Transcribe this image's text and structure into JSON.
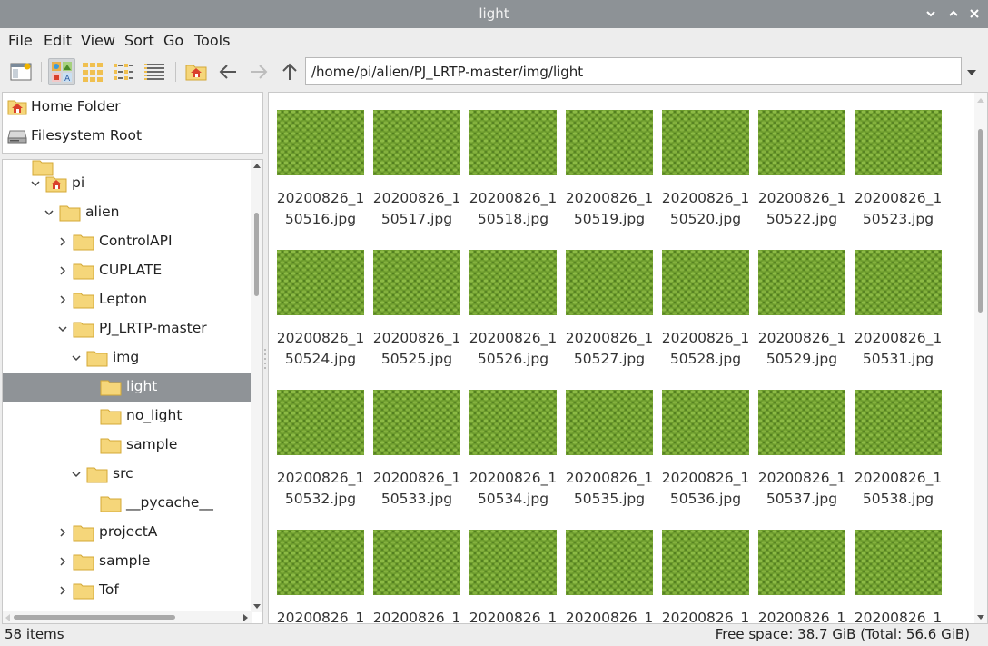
{
  "window": {
    "title": "light",
    "controls": [
      "minimize",
      "maximize",
      "close"
    ]
  },
  "menu": [
    "File",
    "Edit",
    "View",
    "Sort",
    "Go",
    "Tools"
  ],
  "toolbar": {
    "buttons": [
      "new-window-icon",
      "icon-view-icon",
      "thumbnail-view-icon",
      "compact-view-icon",
      "detailed-list-view-icon",
      "home-icon",
      "back-icon",
      "forward-icon",
      "up-icon"
    ],
    "active_view": "icon-view",
    "path": "/home/pi/alien/PJ_LRTP-master/img/light"
  },
  "places": [
    {
      "label": "Home Folder",
      "icon": "home-folder-icon"
    },
    {
      "label": "Filesystem Root",
      "icon": "drive-icon"
    }
  ],
  "tree": [
    {
      "label": "pi",
      "expanded": true
    },
    {
      "label": "alien",
      "expanded": true
    },
    {
      "label": "ControlAPI",
      "expanded": false
    },
    {
      "label": "CUPLATE",
      "expanded": false
    },
    {
      "label": "Lepton",
      "expanded": false
    },
    {
      "label": "PJ_LRTP-master",
      "expanded": true
    },
    {
      "label": "img",
      "expanded": true
    },
    {
      "label": "light",
      "selected": true
    },
    {
      "label": "no_light"
    },
    {
      "label": "sample"
    },
    {
      "label": "src",
      "expanded": true
    },
    {
      "label": "__pycache__"
    },
    {
      "label": "projectA",
      "expanded": false
    },
    {
      "label": "sample",
      "expanded": false
    },
    {
      "label": "Tof",
      "expanded": false
    }
  ],
  "files": [
    [
      "20200826_1",
      "50516.jpg"
    ],
    [
      "20200826_1",
      "50517.jpg"
    ],
    [
      "20200826_1",
      "50518.jpg"
    ],
    [
      "20200826_1",
      "50519.jpg"
    ],
    [
      "20200826_1",
      "50520.jpg"
    ],
    [
      "20200826_1",
      "50522.jpg"
    ],
    [
      "20200826_1",
      "50523.jpg"
    ],
    [
      "20200826_1",
      "50524.jpg"
    ],
    [
      "20200826_1",
      "50525.jpg"
    ],
    [
      "20200826_1",
      "50526.jpg"
    ],
    [
      "20200826_1",
      "50527.jpg"
    ],
    [
      "20200826_1",
      "50528.jpg"
    ],
    [
      "20200826_1",
      "50529.jpg"
    ],
    [
      "20200826_1",
      "50531.jpg"
    ],
    [
      "20200826_1",
      "50532.jpg"
    ],
    [
      "20200826_1",
      "50533.jpg"
    ],
    [
      "20200826_1",
      "50534.jpg"
    ],
    [
      "20200826_1",
      "50535.jpg"
    ],
    [
      "20200826_1",
      "50536.jpg"
    ],
    [
      "20200826_1",
      "50537.jpg"
    ],
    [
      "20200826_1",
      "50538.jpg"
    ],
    [
      "20200826_1",
      ""
    ],
    [
      "20200826_1",
      ""
    ],
    [
      "20200826_1",
      ""
    ],
    [
      "20200826_1",
      ""
    ],
    [
      "20200826_1",
      ""
    ],
    [
      "20200826_1",
      ""
    ],
    [
      "20200826_1",
      ""
    ]
  ],
  "status": {
    "items": "58 items",
    "free_space": "Free space: 38.7 GiB (Total: 56.6 GiB)"
  },
  "colors": {
    "titlebar": "#8d9296",
    "selection": "#8f9397",
    "folder": "#f5d67a",
    "home_roof": "#d9412c",
    "thumbnail": "#6a9a2a"
  }
}
